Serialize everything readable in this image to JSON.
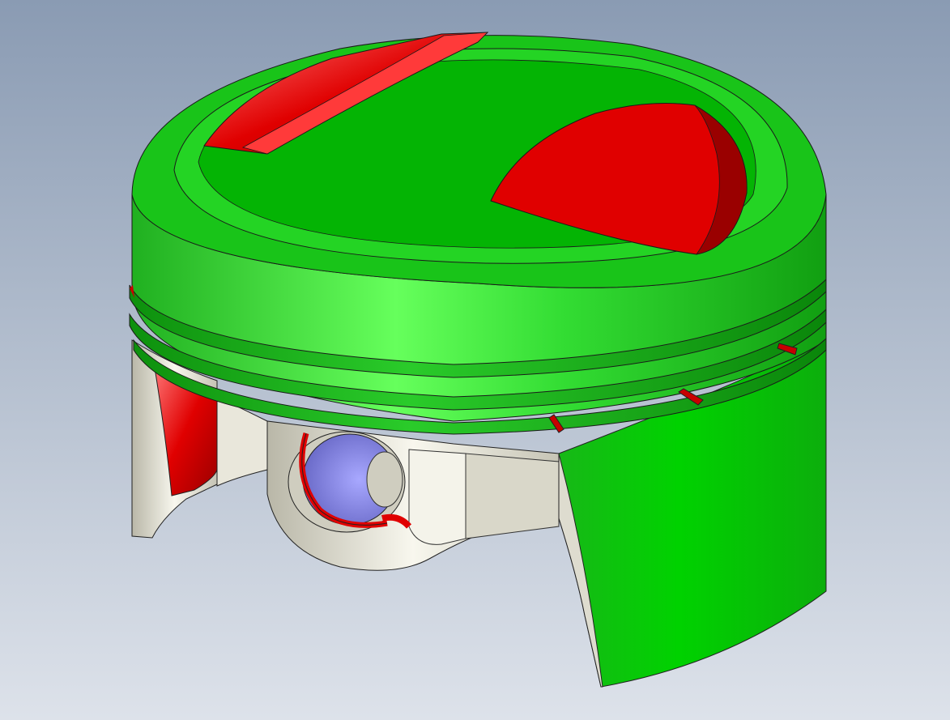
{
  "viewport": {
    "background_top": "#8a9bb3",
    "background_bottom": "#dde2ea"
  },
  "model": {
    "parts": [
      {
        "name": "piston-body",
        "color": "#1ec81e",
        "highlight": "#63ff5a",
        "shadow": "#0a8f0a"
      },
      {
        "name": "valve-reliefs",
        "color": "#e00000",
        "highlight": "#ff7070",
        "shadow": "#8e0000"
      },
      {
        "name": "pin-boss",
        "color": "#e6e4d6",
        "highlight": "#fbfaf1",
        "shadow": "#a9a798"
      },
      {
        "name": "pin-bore",
        "color": "#8a8ae8",
        "highlight": "#b8b8ff",
        "shadow": "#5555b0"
      }
    ],
    "ring_grooves": 3,
    "oil_drain_notches": 3
  }
}
